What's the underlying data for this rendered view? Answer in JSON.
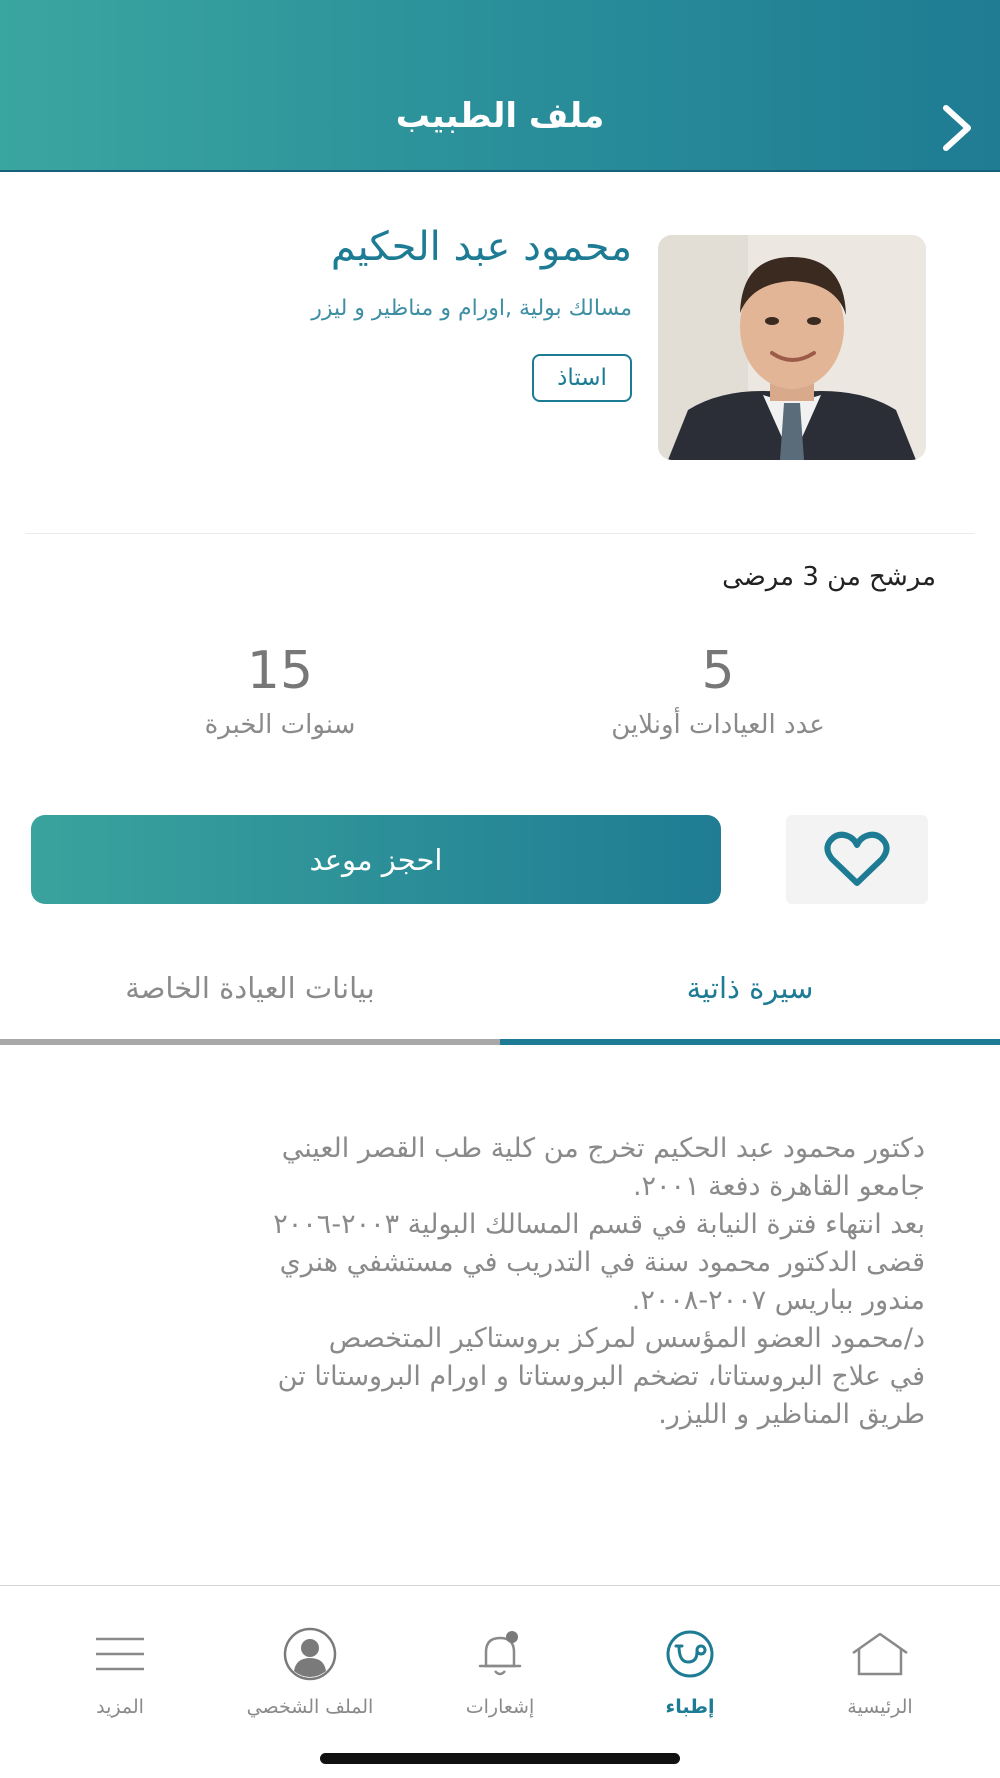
{
  "header": {
    "title": "ملف الطبيب",
    "back_icon": "chevron-right-icon"
  },
  "doctor": {
    "name": "محمود عبد الحكيم",
    "specialty": "مسالك بولية ,اورام و مناظير و ليزر",
    "badge": "استاذ",
    "photo": "doctor-photo"
  },
  "recommendation": "مرشح من 3 مرضى",
  "stats": {
    "online_clinics": {
      "value": "5",
      "label": "عدد العيادات أونلاين"
    },
    "experience_years": {
      "value": "15",
      "label": "سنوات الخبرة"
    }
  },
  "actions": {
    "book_label": "احجز موعد",
    "favorite_icon": "heart-icon"
  },
  "tabs": [
    {
      "label": "سيرة ذاتية",
      "active": true
    },
    {
      "label": "بيانات العيادة الخاصة",
      "active": false
    }
  ],
  "bio": {
    "lines": [
      "دكتور محمود عبد الحكيم تخرج من كلية طب القصر العيني",
      "جامعو القاهرة دفعة ٢٠٠١.",
      "بعد انتهاء فترة النيابة في قسم المسالك البولية ٢٠٠٣-٢٠٠٦",
      "قضى الدكتور محمود سنة في التدريب في مستشفي هنري",
      "مندور بباريس ٢٠٠٧-٢٠٠٨.",
      "د/محمود العضو المؤسس لمركز بروستاكير المتخصص",
      "في علاج البروستاتا، تضخم البروستاتا و اورام البروستاتا تن",
      "طريق المناظير و الليزر."
    ]
  },
  "bottom_nav": [
    {
      "label": "الرئيسية",
      "icon": "home-icon",
      "active": false
    },
    {
      "label": "إطباء",
      "icon": "doctors-icon",
      "active": true
    },
    {
      "label": "إشعارات",
      "icon": "bell-icon",
      "active": false
    },
    {
      "label": "الملف الشخصي",
      "icon": "user-icon",
      "active": false
    },
    {
      "label": "المزيد",
      "icon": "menu-icon",
      "active": false
    }
  ],
  "colors": {
    "accent": "#1d7c93",
    "header_start": "#3aa6a0",
    "header_end": "#1f7c93",
    "muted_text": "#8a8a8a"
  }
}
